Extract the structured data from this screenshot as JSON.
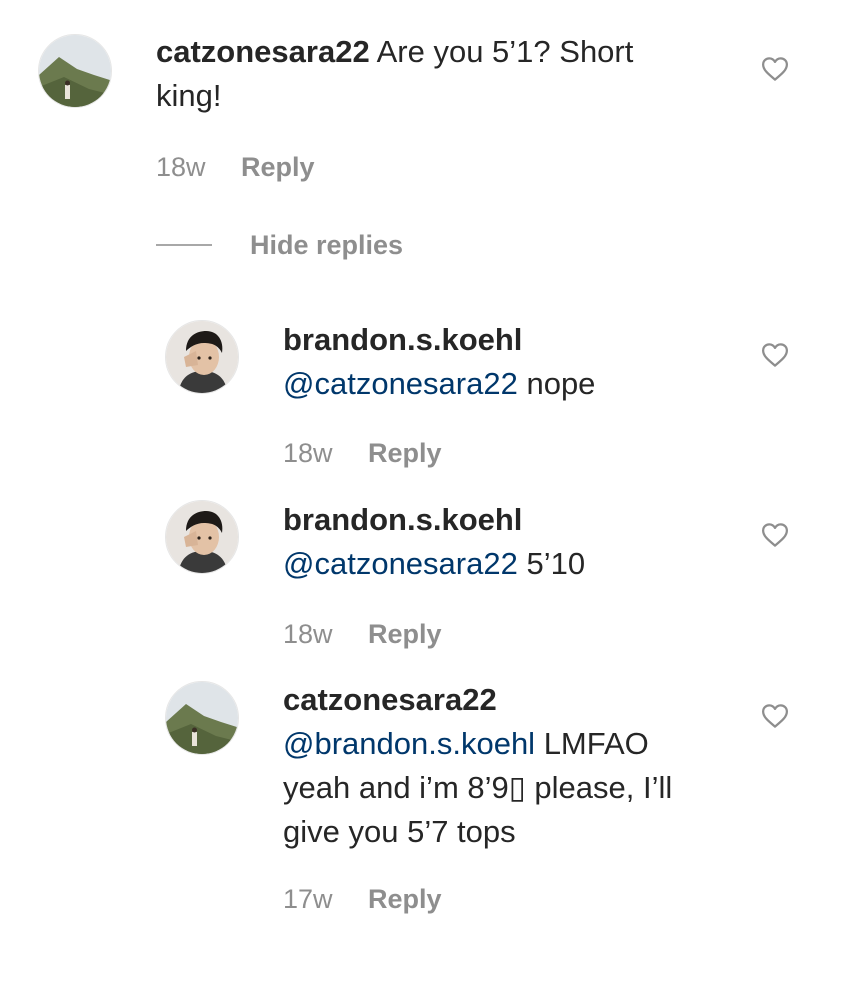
{
  "comments": [
    {
      "username": "catzonesara22",
      "text": "Are you 5’1? Short",
      "text_line2": "king!",
      "time": "18w",
      "reply_label": "Reply",
      "avatar_icon": "mountain-landscape-avatar"
    }
  ],
  "hide_replies_label": "Hide replies",
  "replies": [
    {
      "username": "brandon.s.koehl",
      "mention": "@catzonesara22",
      "text": " nope",
      "time": "18w",
      "reply_label": "Reply",
      "avatar_icon": "portrait-avatar"
    },
    {
      "username": "brandon.s.koehl",
      "mention": "@catzonesara22",
      "text": " 5’10",
      "time": "18w",
      "reply_label": "Reply",
      "avatar_icon": "portrait-avatar"
    },
    {
      "username": "catzonesara22",
      "mention": "@brandon.s.koehl",
      "text": " LMFAO",
      "text_line2": "yeah and i’m 8’9▯ please, I’ll",
      "text_line3": "give you 5’7 tops",
      "time": "17w",
      "reply_label": "Reply",
      "avatar_icon": "mountain-landscape-avatar"
    }
  ],
  "colors": {
    "text": "#262626",
    "secondary": "#8e8e8e",
    "mention": "#00376b",
    "background": "#ffffff"
  }
}
